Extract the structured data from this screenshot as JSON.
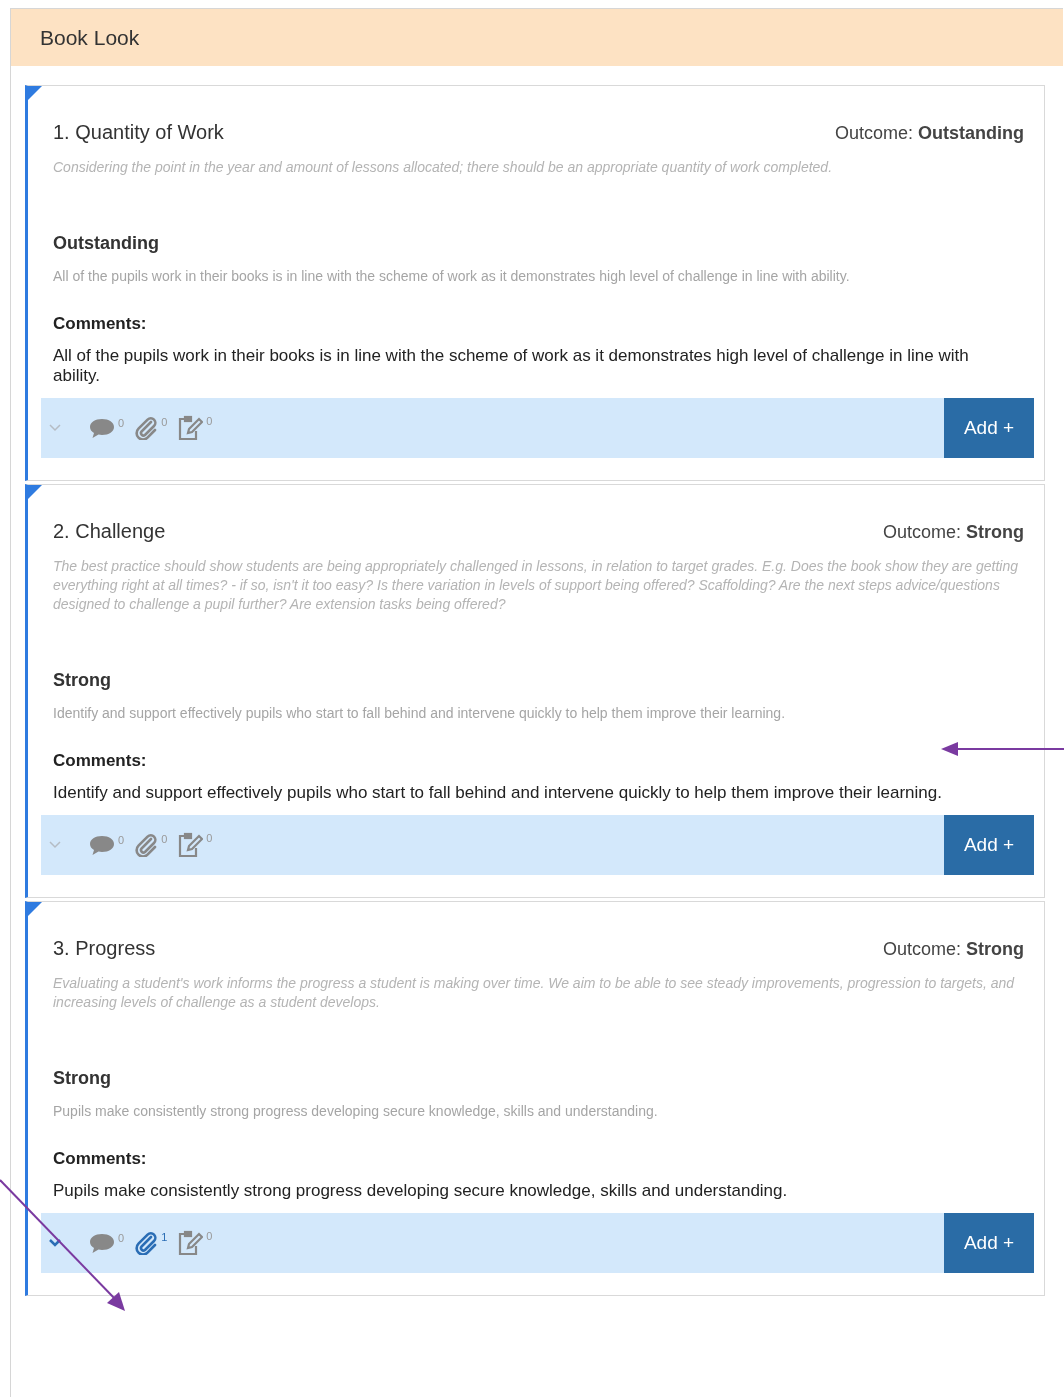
{
  "panel": {
    "title": "Book Look"
  },
  "items": [
    {
      "title": "1. Quantity of Work",
      "outcome_label": "Outcome:",
      "outcome": "Outstanding",
      "description": "Considering the point in the year and amount of lessons allocated; there should be an appropriate quantity of work completed.",
      "level": "Outstanding",
      "level_description": "All of the pupils work in their books is in line with the scheme of work as it demonstrates high level of challenge in line with ability.",
      "comments_label": "Comments:",
      "comment": "All of the pupils work in their books is in line with the scheme of work as it demonstrates high level of challenge in line with ability.",
      "expanded": false,
      "counters": [
        {
          "kind": "comments",
          "count": "0",
          "active": false
        },
        {
          "kind": "attachments",
          "count": "0",
          "active": false
        },
        {
          "kind": "notes",
          "count": "0",
          "active": false
        }
      ],
      "button": "Add +"
    },
    {
      "title": "2. Challenge",
      "outcome_label": "Outcome:",
      "outcome": "Strong",
      "description": "The best practice should show students are being appropriately challenged in lessons, in relation to target grades. E.g. Does the book show they are getting everything right at all times? - if so, isn't it too easy? Is there variation in levels of support being offered? Scaffolding? Are the next steps advice/questions designed to challenge a pupil further? Are extension tasks being offered?",
      "level": "Strong",
      "level_description": "Identify and support effectively pupils who start to fall behind and intervene quickly to help them improve their learning.",
      "comments_label": "Comments:",
      "comment": "Identify and support effectively pupils who start to fall behind and intervene quickly to help them improve their learning.",
      "expanded": false,
      "counters": [
        {
          "kind": "comments",
          "count": "0",
          "active": false
        },
        {
          "kind": "attachments",
          "count": "0",
          "active": false
        },
        {
          "kind": "notes",
          "count": "0",
          "active": false
        }
      ],
      "button": "Add +"
    },
    {
      "title": "3. Progress",
      "outcome_label": "Outcome:",
      "outcome": "Strong",
      "description": "Evaluating a student's work informs the progress a student is making over time. We aim to be able to see steady improvements, progression to targets, and increasing levels of challenge as a student develops.",
      "level": "Strong",
      "level_description": "Pupils make consistently strong progress developing secure knowledge, skills and understanding.",
      "comments_label": "Comments:",
      "comment": "Pupils make consistently strong progress developing secure knowledge, skills and understanding.",
      "expanded": true,
      "counters": [
        {
          "kind": "comments",
          "count": "0",
          "active": false
        },
        {
          "kind": "attachments",
          "count": "1",
          "active": true
        },
        {
          "kind": "notes",
          "count": "0",
          "active": false
        }
      ],
      "button": "Add +"
    }
  ]
}
